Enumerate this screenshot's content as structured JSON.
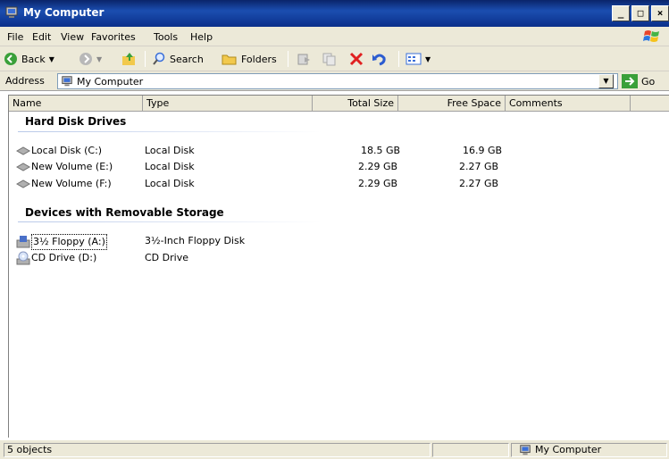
{
  "window": {
    "title": "My Computer",
    "minimize": "_",
    "maximize": "□",
    "close": "×"
  },
  "menu": {
    "file": "File",
    "edit": "Edit",
    "view": "View",
    "favorites": "Favorites",
    "tools": "Tools",
    "help": "Help"
  },
  "toolbar": {
    "back": "Back",
    "search": "Search",
    "folders": "Folders"
  },
  "address": {
    "label": "Address",
    "value": "My Computer",
    "go": "Go"
  },
  "columns": {
    "name": "Name",
    "type": "Type",
    "total_size": "Total Size",
    "free_space": "Free Space",
    "comments": "Comments"
  },
  "groups": {
    "hard_disks": {
      "label": "Hard Disk Drives",
      "items": [
        {
          "name": "Local Disk (C:)",
          "type": "Local Disk",
          "total": "18.5 GB",
          "free": "16.9 GB"
        },
        {
          "name": "New Volume (E:)",
          "type": "Local Disk",
          "total": "2.29 GB",
          "free": "2.27 GB"
        },
        {
          "name": "New Volume (F:)",
          "type": "Local Disk",
          "total": "2.29 GB",
          "free": "2.27 GB"
        }
      ]
    },
    "removable": {
      "label": "Devices with Removable Storage",
      "items": [
        {
          "name": "3½ Floppy (A:)",
          "type": "3½-Inch Floppy Disk"
        },
        {
          "name": "CD Drive (D:)",
          "type": "CD Drive"
        }
      ]
    }
  },
  "status": {
    "objects": "5 objects",
    "location": "My Computer"
  },
  "colors": {
    "title_bar": "#0a246a",
    "chrome": "#ece9d8",
    "group_line": "#b8c8e8"
  }
}
